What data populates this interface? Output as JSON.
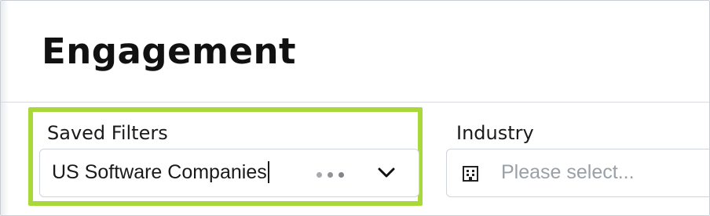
{
  "header": {
    "title": "Engagement"
  },
  "filters": {
    "saved_filters": {
      "label": "Saved Filters",
      "value": "US Software Companies",
      "more_icon": "more-horizontal-icon",
      "dropdown_icon": "chevron-down-icon"
    },
    "industry": {
      "label": "Industry",
      "placeholder": "Please select...",
      "icon": "building-icon"
    }
  },
  "colors": {
    "highlight": "#a8d83a",
    "text": "#1a1a1a",
    "placeholder": "#9aa0a6",
    "border": "#cfd4da"
  }
}
